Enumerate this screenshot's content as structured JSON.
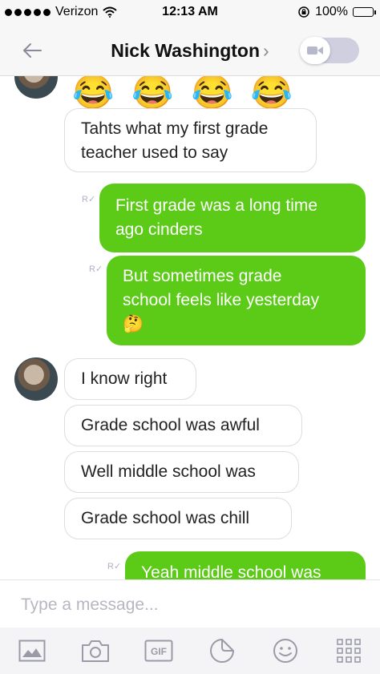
{
  "status_bar": {
    "carrier": "Verizon",
    "time": "12:13 AM",
    "battery": "100%"
  },
  "header": {
    "contact_name": "Nick Washington",
    "chevron": "›"
  },
  "messages": {
    "emoji_row": [
      "😂",
      "😂",
      "😂",
      "😂"
    ],
    "m1": {
      "line1": "Tahts what my first grade",
      "line2": "teacher used to say"
    },
    "m2": {
      "line1": "First grade was a long time",
      "line2": "ago cinders"
    },
    "m3": {
      "line1": "But sometimes grade",
      "line2": "school feels like yesterday",
      "line3": "🤔"
    },
    "m4": "I know right",
    "m5": "Grade school was awful",
    "m6": "Well middle school was",
    "m7": "Grade school was chill",
    "m8": "Yeah middle school was",
    "read_mark": "R"
  },
  "composer": {
    "placeholder": "Type a message..."
  },
  "toolbar": {
    "gif_label": "GIF"
  },
  "colors": {
    "outgoing_bubble": "#5ccb18",
    "incoming_border": "#dddddd",
    "icon_gray": "#9a9aa8"
  },
  "icons": [
    "back-arrow-icon",
    "chevron-right-icon",
    "video-icon",
    "photo-icon",
    "camera-icon",
    "gif-icon",
    "sticker-icon",
    "smiley-icon",
    "grid-icon"
  ]
}
